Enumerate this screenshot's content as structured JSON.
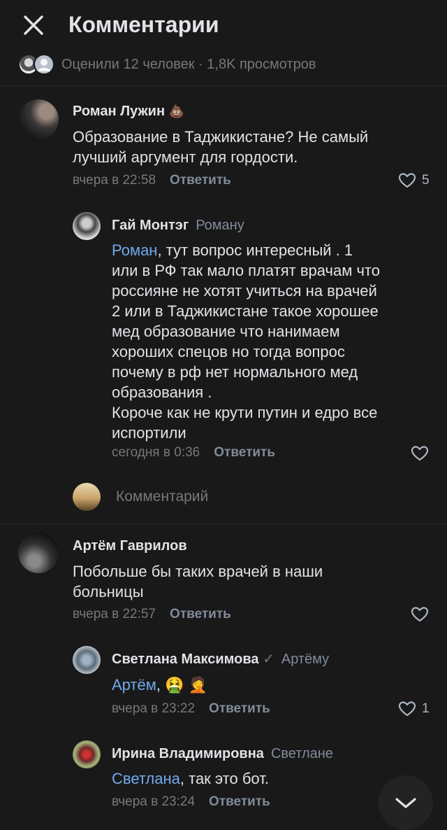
{
  "header": {
    "title": "Комментарии"
  },
  "likes_summary": "Оценили 12 человек · 1,8K просмотров",
  "reply_label": "Ответить",
  "compose_placeholder": "Комментарий",
  "comments": [
    {
      "author": "Роман Лужин",
      "emoji": "💩",
      "text": "Образование в Таджикистане? Не самый\nлучший аргумент для гордости.",
      "time": "вчера в 22:58",
      "likes": "5"
    },
    {
      "author": "Гай Монтэг",
      "reply_to": "Роману",
      "mention": "Роман",
      "text": ", тут вопрос интересный . 1\nили в РФ так мало платят врачам что\nроссияне не хотят учиться на врачей\n2 или в Таджикистане такое хорошее\nмед образование что нанимаем\nхороших спецов но тогда вопрос\nпочему в рф нет нормального мед\nобразования .\nКороче как не крути путин и едро все\nиспортили",
      "time": "сегодня в 0:36",
      "likes": ""
    },
    {
      "author": "Артём Гаврилов",
      "text": "Побольше бы таких врачей в наши\nбольницы",
      "time": "вчера в 22:57",
      "likes": ""
    },
    {
      "author": "Светлана Максимова",
      "verified": "✓",
      "reply_to": "Артёму",
      "mention": "Артём",
      "text": ", 🤮 🤦",
      "time": "вчера в 23:22",
      "likes": "1"
    },
    {
      "author": "Ирина Владимировна",
      "reply_to": "Светлане",
      "mention": "Светлана",
      "text": ", так это бот.",
      "time": "вчера в 23:24",
      "likes": ""
    }
  ],
  "colors": {
    "background": "#19191a",
    "accent": "#71aaeb",
    "secondary": "#76787a",
    "primary_text": "#e1e3e6"
  }
}
